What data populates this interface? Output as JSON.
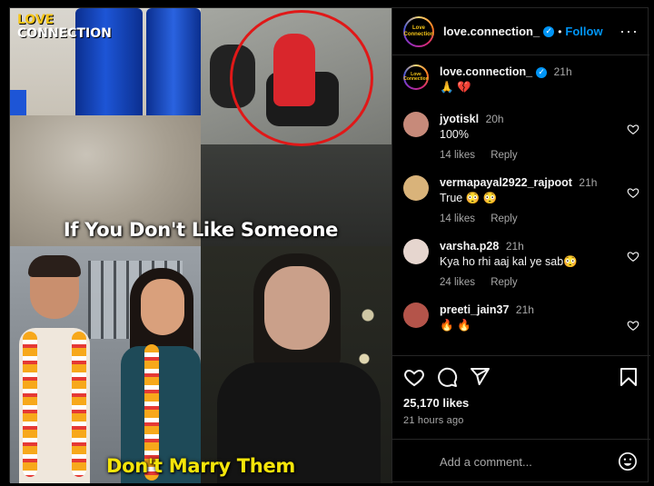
{
  "media": {
    "logo_line1": "LOVE",
    "logo_line2": "CONNECTION",
    "caption_top": "If You Don't Like Someone",
    "caption_bottom": "Don't Marry Them"
  },
  "header": {
    "username": "love.connection_",
    "dot": "•",
    "follow_label": "Follow",
    "more_label": "···",
    "avatar_text": "Love Connection"
  },
  "post_caption": {
    "username": "love.connection_",
    "time": "21h",
    "text": "🙏 💔"
  },
  "comments": [
    {
      "username": "jyotiskl",
      "time": "20h",
      "text": "100%",
      "likes": "14 likes",
      "reply": "Reply",
      "avatar_color": "#c78a7a"
    },
    {
      "username": "vermapayal2922_rajpoot",
      "time": "21h",
      "text": "True 😳 😳",
      "likes": "14 likes",
      "reply": "Reply",
      "avatar_color": "#d9b37a"
    },
    {
      "username": "varsha.p28",
      "time": "21h",
      "text": "Kya ho rhi aaj kal ye sab😳",
      "likes": "24 likes",
      "reply": "Reply",
      "avatar_color": "#e6d6cf"
    },
    {
      "username": "preeti_jain37",
      "time": "21h",
      "text": "🔥 🔥",
      "likes": "",
      "reply": "",
      "avatar_color": "#b4544a"
    }
  ],
  "actions": {
    "likes_count": "25,170 likes",
    "time_ago": "21 hours ago"
  },
  "add_comment": {
    "placeholder": "Add a comment..."
  },
  "colors": {
    "accent": "#0095f6",
    "background": "#000000",
    "secondary_text": "#a8a8a8",
    "caption_yellow": "#f5e50a"
  }
}
